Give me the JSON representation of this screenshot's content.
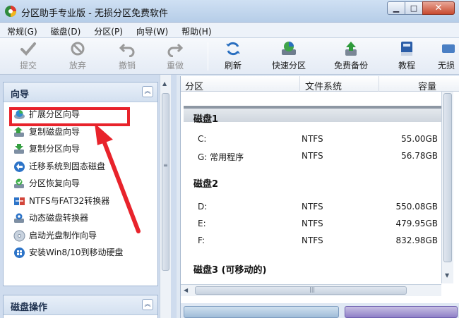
{
  "window": {
    "title": "分区助手专业版 - 无损分区免费软件",
    "minimize": "▁",
    "maximize": "□",
    "close": "✕"
  },
  "menu": [
    "常规(G)",
    "磁盘(D)",
    "分区(P)",
    "向导(W)",
    "帮助(H)"
  ],
  "toolbar": {
    "submit": "提交",
    "discard": "放弃",
    "undo": "撤销",
    "redo": "重做",
    "refresh": "刷新",
    "quick_partition": "快速分区",
    "free_backup": "免费备份",
    "tutorial": "教程",
    "more": "无损"
  },
  "wizard_panel": {
    "title": "向导",
    "collapse": "︽",
    "items": [
      "扩展分区向导",
      "复制磁盘向导",
      "复制分区向导",
      "迁移系统到固态磁盘",
      "分区恢复向导",
      "NTFS与FAT32转换器",
      "动态磁盘转换器",
      "启动光盘制作向导",
      "安装Win8/10到移动硬盘"
    ]
  },
  "disk_ops_panel": {
    "title": "磁盘操作",
    "collapse": "︽"
  },
  "columns": {
    "partition": "分区",
    "filesystem": "文件系统",
    "capacity": "容量"
  },
  "disks": [
    {
      "name": "磁盘1",
      "partitions": [
        {
          "name": "C:",
          "fs": "NTFS",
          "size": "55.00GB"
        },
        {
          "name": "G: 常用程序",
          "fs": "NTFS",
          "size": "56.78GB"
        }
      ]
    },
    {
      "name": "磁盘2",
      "partitions": [
        {
          "name": "D:",
          "fs": "NTFS",
          "size": "550.08GB"
        },
        {
          "name": "E:",
          "fs": "NTFS",
          "size": "479.95GB"
        },
        {
          "name": "F:",
          "fs": "NTFS",
          "size": "832.98GB"
        }
      ]
    },
    {
      "name": "磁盘3 (可移动的)",
      "partitions": []
    }
  ],
  "colors": {
    "highlight": "#e8232b",
    "accent": "#3a6fb0"
  }
}
